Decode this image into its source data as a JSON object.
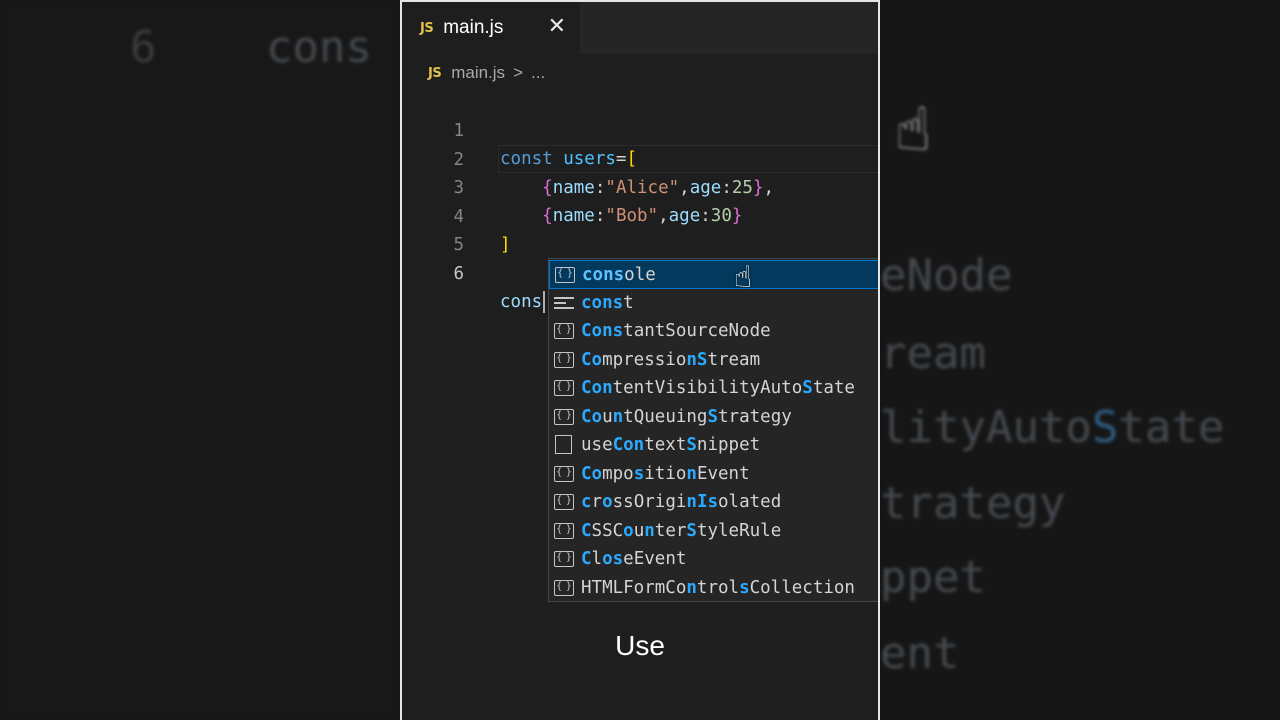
{
  "background": {
    "left_line_number": "6",
    "left_text": "cons",
    "right_lines": [
      {
        "pre": "eNode",
        "hl": "",
        "post": ""
      },
      {
        "pre": "ream",
        "hl": "",
        "post": ""
      },
      {
        "pre": "lityAuto",
        "hl": "S",
        "post": "tate"
      },
      {
        "pre": "trategy",
        "hl": "",
        "post": ""
      },
      {
        "pre": "ppet",
        "hl": "",
        "post": ""
      },
      {
        "pre": "ent",
        "hl": "",
        "post": ""
      }
    ]
  },
  "tab": {
    "badge": "JS",
    "label": "main.js",
    "close": "✕"
  },
  "breadcrumb": {
    "badge": "JS",
    "file": "main.js",
    "sep": ">",
    "rest": "..."
  },
  "code": {
    "line_numbers": [
      "1",
      "2",
      "3",
      "4",
      "5",
      "6"
    ],
    "typed": "cons",
    "line1": {
      "kw": "const",
      "var": "users",
      "op": "=",
      "bracket": "["
    },
    "line2": {
      "open": "{",
      "k1": "name",
      "c1": ":",
      "v1": "\"Alice\"",
      "comma1": ",",
      "k2": "age",
      "c2": ":",
      "v2": "25",
      "close": "}",
      "comma2": ","
    },
    "line3": {
      "open": "{",
      "k1": "name",
      "c1": ":",
      "v1": "\"Bob\"",
      "comma1": ",",
      "k2": "age",
      "c2": ":",
      "v2": "30",
      "close": "}"
    },
    "line4": {
      "bracket": "]"
    }
  },
  "suggestions": [
    {
      "icon": "variable-icon",
      "parts": [
        {
          "t": "cons",
          "m": true
        },
        {
          "t": "ole",
          "m": false
        }
      ],
      "selected": true
    },
    {
      "icon": "keyword-icon",
      "parts": [
        {
          "t": "cons",
          "m": true
        },
        {
          "t": "t",
          "m": false
        }
      ]
    },
    {
      "icon": "variable-icon",
      "parts": [
        {
          "t": "Cons",
          "m": true
        },
        {
          "t": "tantSourceNode",
          "m": false
        }
      ]
    },
    {
      "icon": "variable-icon",
      "parts": [
        {
          "t": "Co",
          "m": true
        },
        {
          "t": "mpressio",
          "m": false
        },
        {
          "t": "nS",
          "m": true
        },
        {
          "t": "tream",
          "m": false
        }
      ]
    },
    {
      "icon": "variable-icon",
      "parts": [
        {
          "t": "Con",
          "m": true
        },
        {
          "t": "tentVisibilityAuto",
          "m": false
        },
        {
          "t": "S",
          "m": true
        },
        {
          "t": "tate",
          "m": false
        }
      ]
    },
    {
      "icon": "variable-icon",
      "parts": [
        {
          "t": "Co",
          "m": true
        },
        {
          "t": "u",
          "m": false
        },
        {
          "t": "n",
          "m": true
        },
        {
          "t": "tQueuing",
          "m": false
        },
        {
          "t": "S",
          "m": true
        },
        {
          "t": "trategy",
          "m": false
        }
      ]
    },
    {
      "icon": "snippet-icon",
      "parts": [
        {
          "t": "use",
          "m": false
        },
        {
          "t": "Con",
          "m": true
        },
        {
          "t": "text",
          "m": false
        },
        {
          "t": "S",
          "m": true
        },
        {
          "t": "nippet",
          "m": false
        }
      ]
    },
    {
      "icon": "variable-icon",
      "parts": [
        {
          "t": "Co",
          "m": true
        },
        {
          "t": "mpo",
          "m": false
        },
        {
          "t": "s",
          "m": true
        },
        {
          "t": "itio",
          "m": false
        },
        {
          "t": "n",
          "m": true
        },
        {
          "t": "Event",
          "m": false
        }
      ]
    },
    {
      "icon": "variable-icon",
      "parts": [
        {
          "t": "c",
          "m": true
        },
        {
          "t": "r",
          "m": false
        },
        {
          "t": "o",
          "m": true
        },
        {
          "t": "ssOrigi",
          "m": false
        },
        {
          "t": "nIs",
          "m": true
        },
        {
          "t": "olated",
          "m": false
        }
      ]
    },
    {
      "icon": "variable-icon",
      "parts": [
        {
          "t": "C",
          "m": true
        },
        {
          "t": "SSC",
          "m": false
        },
        {
          "t": "o",
          "m": true
        },
        {
          "t": "u",
          "m": false
        },
        {
          "t": "n",
          "m": true
        },
        {
          "t": "ter",
          "m": false
        },
        {
          "t": "S",
          "m": true
        },
        {
          "t": "tyleRule",
          "m": false
        }
      ]
    },
    {
      "icon": "variable-icon",
      "parts": [
        {
          "t": "C",
          "m": true
        },
        {
          "t": "l",
          "m": false
        },
        {
          "t": "os",
          "m": true
        },
        {
          "t": "eEvent",
          "m": false
        }
      ]
    },
    {
      "icon": "variable-icon",
      "parts": [
        {
          "t": "HTMLFormCo",
          "m": false
        },
        {
          "t": "n",
          "m": true
        },
        {
          "t": "trol",
          "m": false
        },
        {
          "t": "s",
          "m": true
        },
        {
          "t": "Collection",
          "m": false
        }
      ]
    }
  ],
  "caption": "Use"
}
